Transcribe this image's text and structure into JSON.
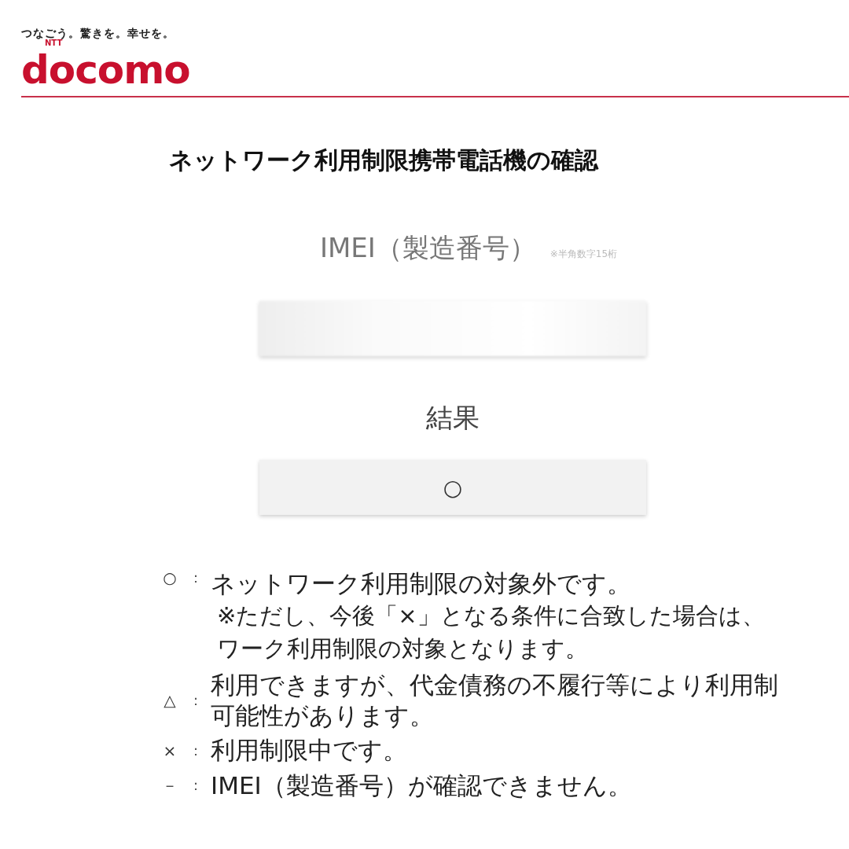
{
  "header": {
    "tagline": "つなごう。驚きを。幸せを。",
    "logo_super": "NTT",
    "logo": "docomo"
  },
  "title": "ネットワーク利用制限携帯電話機の確認",
  "imei": {
    "label": "IMEI（製造番号）",
    "hint": "※半角数字15桁"
  },
  "result": {
    "label": "結果",
    "value": "○"
  },
  "legend": [
    {
      "symbol": "○",
      "colon": "：",
      "lines": [
        "ネットワーク利用制限の対象外です。"
      ],
      "notes": [
        "※ただし、今後「×」となる条件に合致した場合は、",
        "ワーク利用制限の対象となります。"
      ]
    },
    {
      "symbol": "△",
      "colon": "：",
      "lines": [
        "利用できますが、代金債務の不履行等により利用制",
        "可能性があります。"
      ]
    },
    {
      "symbol": "×",
      "colon": "：",
      "lines": [
        "利用制限中です。"
      ]
    },
    {
      "symbol": "－",
      "colon": "：",
      "lines": [
        "IMEI（製造番号）が確認できません。"
      ]
    }
  ]
}
